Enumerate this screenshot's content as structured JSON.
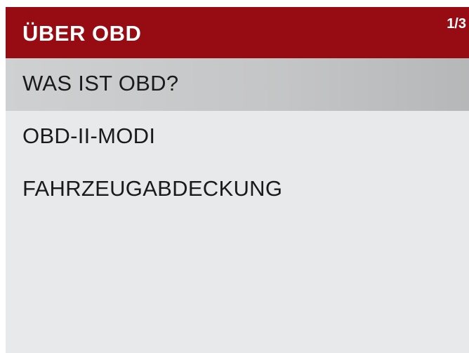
{
  "header": {
    "title": "ÜBER OBD",
    "page_indicator": "1/3"
  },
  "menu": {
    "items": [
      {
        "label": "WAS IST OBD?",
        "selected": true
      },
      {
        "label": "OBD-II-MODI",
        "selected": false
      },
      {
        "label": "FAHRZEUGABDECKUNG",
        "selected": false
      }
    ]
  },
  "colors": {
    "header_background": "#960c12",
    "header_text": "#ffffff",
    "screen_background": "#e8e9ea",
    "selected_background": "#c4c5c6",
    "item_text": "#1a1a1a"
  }
}
